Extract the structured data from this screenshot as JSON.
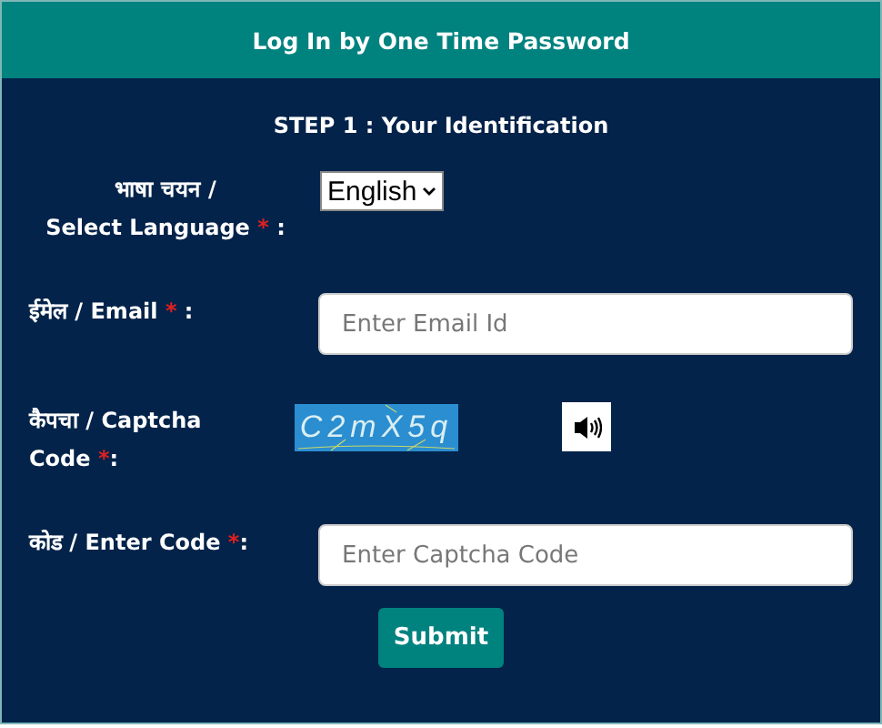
{
  "header": {
    "title": "Log In by One Time Password"
  },
  "step_title": "STEP 1 : Your Identification",
  "fields": [
    {
      "kind": "select",
      "label": "भाषा चयन /\nSelect Language ",
      "required_mark": "*",
      "label_end": " :",
      "value": "English"
    },
    {
      "kind": "text",
      "label": "ईमेल / Email ",
      "required_mark": "*",
      "label_end": " :",
      "placeholder": "Enter Email Id"
    },
    {
      "kind": "captcha",
      "label": "कैपचा / Captcha\nCode ",
      "required_mark": "*",
      "label_end": ":",
      "captcha_text": "C2mX5q"
    },
    {
      "kind": "text",
      "label": "कोड / Enter Code ",
      "required_mark": "*",
      "label_end": ":",
      "placeholder": "Enter Captcha Code"
    }
  ],
  "submit": "Submit"
}
